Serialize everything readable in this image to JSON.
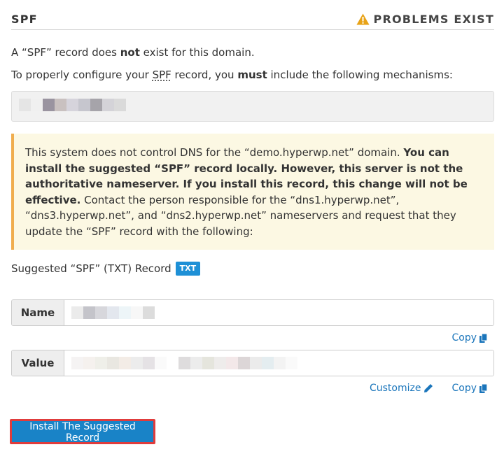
{
  "header": {
    "title": "SPF",
    "status": "PROBLEMS EXIST",
    "status_icon": "warning-triangle-icon",
    "status_color": "#e8a317"
  },
  "intro": {
    "line1_pre": "A “SPF” record does ",
    "line1_bold": "not",
    "line1_post": " exist for this domain.",
    "line2_pre": "To properly configure your ",
    "line2_abbr": "SPF",
    "line2_mid": " record, you ",
    "line2_bold": "must",
    "line2_post": " include the following mechanisms:"
  },
  "alert": {
    "text1": "This system does not control DNS for the “demo.hyperwp.net” domain. ",
    "bold": "You can install the suggested “SPF” record locally. However, this server is not the authoritative nameserver. If you install this record, this change will not be effective.",
    "text2": " Contact the person responsible for the “dns1.hyperwp.net”, “dns3.hyperwp.net”, and “dns2.hyperwp.net” nameservers and request that they update the “SPF” record with the following:"
  },
  "suggested": {
    "label": "Suggested “SPF” (TXT) Record",
    "badge": "TXT"
  },
  "name_field": {
    "label": "Name"
  },
  "value_field": {
    "label": "Value"
  },
  "actions": {
    "copy": "Copy",
    "customize": "Customize",
    "install": "Install The Suggested Record"
  },
  "colors": {
    "accent": "#1a75bb",
    "button": "#1983c7",
    "alert_bg": "#fcf8e3",
    "alert_border": "#f0ad4e",
    "highlight": "#e03c3c"
  }
}
